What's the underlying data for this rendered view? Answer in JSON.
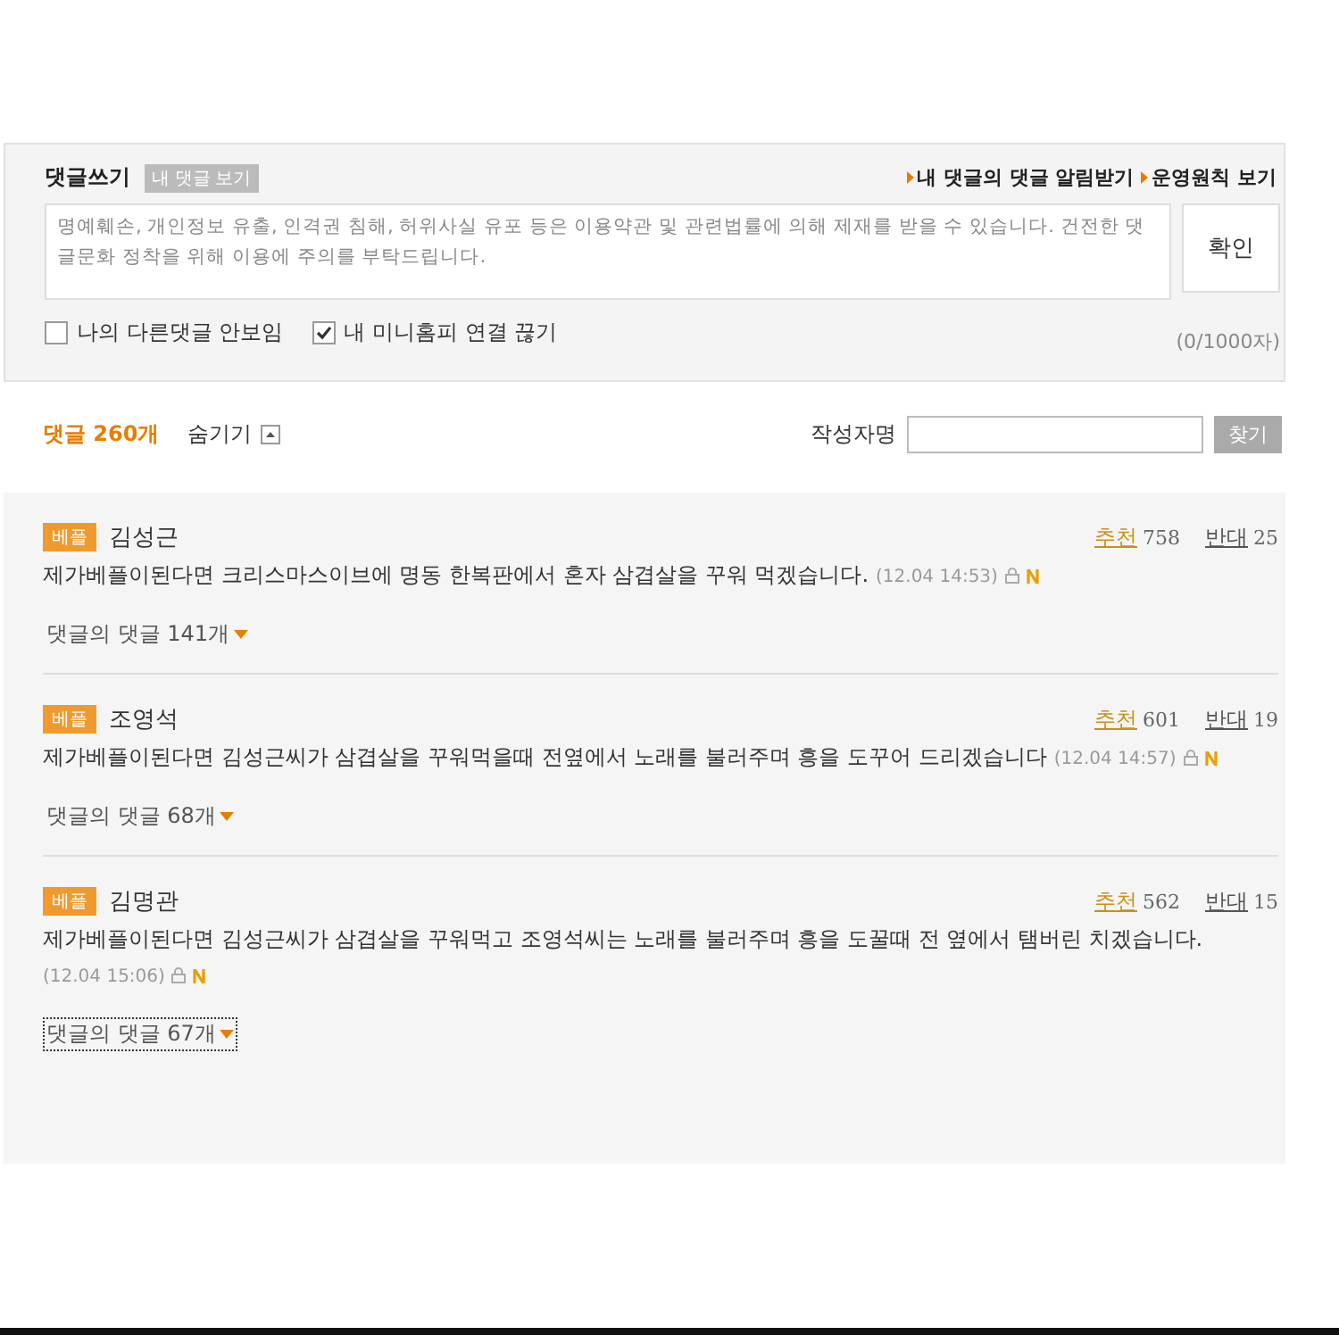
{
  "write_box": {
    "title": "댓글쓰기",
    "my_comments_button": "내 댓글 보기",
    "links": [
      "내 댓글의 댓글 알림받기",
      "운영원칙 보기"
    ],
    "placeholder": "명예훼손, 개인정보 유출, 인격권 침해, 허위사실 유포 등은 이용약관 및 관련법률에 의해 제재를 받을 수 있습니다. 건전한 댓글문화 정착을 위해 이용에 주의를 부탁드립니다.",
    "submit": "확인",
    "options": [
      {
        "label": "나의 다른댓글 안보임",
        "checked": false
      },
      {
        "label": "내 미니홈피 연결 끊기",
        "checked": true
      }
    ],
    "char_count": "(0/1000자)"
  },
  "list_header": {
    "count": "댓글 260개",
    "hide": "숨기기",
    "author_label": "작성자명",
    "search_button": "찾기"
  },
  "comments": [
    {
      "badge": "베플",
      "author": "김성근",
      "up_label": "추천",
      "up": "758",
      "down_label": "반대",
      "down": "25",
      "text": "제가베플이된다면 크리스마스이브에 명동 한복판에서 혼자 삼겹살을 꾸워 먹겠습니다.",
      "time": "(12.04 14:53)",
      "replies": "댓글의 댓글 141개",
      "focused": false
    },
    {
      "badge": "베플",
      "author": "조영석",
      "up_label": "추천",
      "up": "601",
      "down_label": "반대",
      "down": "19",
      "text": "제가베플이된다면 김성근씨가 삼겹살을 꾸워먹을때 전옆에서 노래를 불러주며 흥을 도꾸어 드리겠습니다",
      "time": "(12.04 14:57)",
      "replies": "댓글의 댓글 68개",
      "focused": false
    },
    {
      "badge": "베플",
      "author": "김명관",
      "up_label": "추천",
      "up": "562",
      "down_label": "반대",
      "down": "15",
      "text": "제가베플이된다면 김성근씨가 삼겹살을 꾸워먹고 조영석씨는 노래를 불러주며 흥을 도꿀때 전 옆에서 탬버린 치겠습니다.",
      "time": "(12.04 15:06)",
      "replies": "댓글의 댓글 67개",
      "focused": true
    }
  ]
}
